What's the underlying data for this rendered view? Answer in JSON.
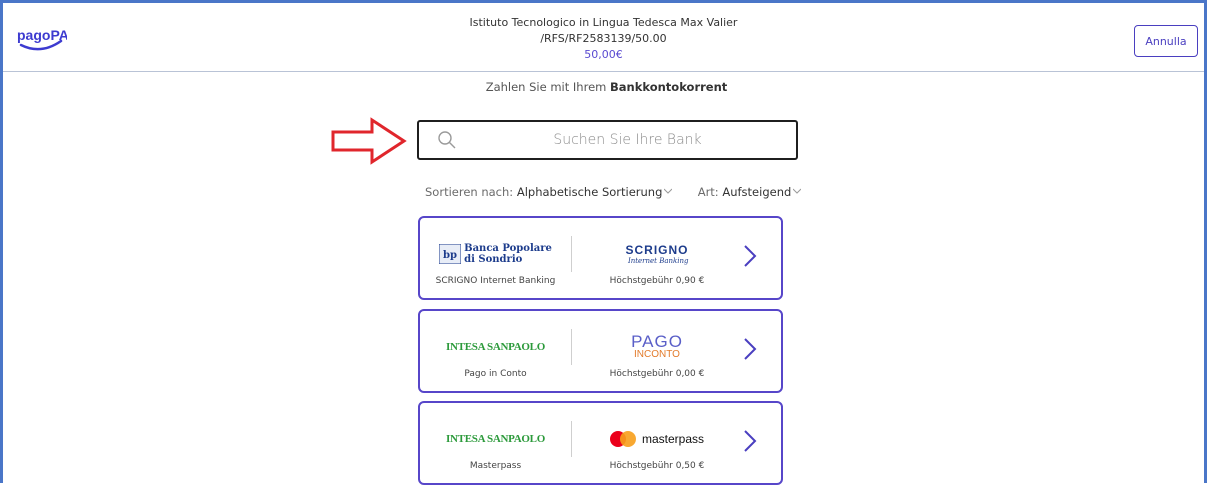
{
  "header": {
    "logo_text": "pagoPA",
    "institution": "Istituto Tecnologico in Lingua Tedesca Max Valier",
    "reference": "/RFS/RF2583139/50.00",
    "amount": "50,00€",
    "cancel_label": "Annulla"
  },
  "subtitle": {
    "prefix": "Zahlen Sie mit Ihrem",
    "method": "Bankkontokorrent"
  },
  "search": {
    "placeholder": "Suchen Sie Ihre Bank"
  },
  "sort": {
    "label": "Sortieren nach:",
    "value": "Alphabetische Sortierung",
    "type_label": "Art:",
    "type_value": "Aufsteigend"
  },
  "banks": [
    {
      "bank_logo_text": [
        "Banca Popolare",
        "di Sondrio"
      ],
      "service_logo_text": "SCRIGNO",
      "service_logo_subtext": "Internet Banking",
      "service_name": "SCRIGNO Internet Banking",
      "fee": "Höchstgebühr 0,90 €"
    },
    {
      "bank_logo_text": "INTESA SANPAOLO",
      "service_logo_text": "PAGO",
      "service_logo_subtext": "INCONTO",
      "service_name": "Pago in Conto",
      "fee": "Höchstgebühr 0,00 €"
    },
    {
      "bank_logo_text": "INTESA SANPAOLO",
      "service_logo_text": "masterpass",
      "service_name": "Masterpass",
      "fee": "Höchstgebühr 0,50 €"
    }
  ],
  "colors": {
    "accent": "#5746c9",
    "frame": "#4a76c8",
    "annotation_arrow": "#e0262c"
  }
}
